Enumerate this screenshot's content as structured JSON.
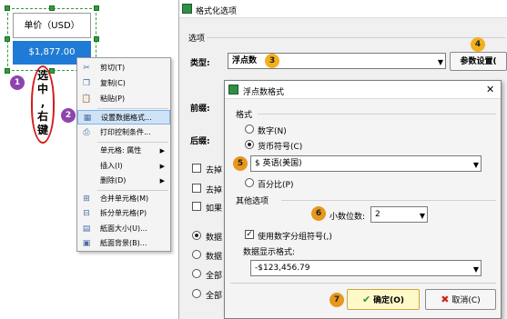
{
  "designer": {
    "unit_label": "单价（USD）",
    "value": "$1,877.00",
    "note_chars": [
      "选",
      "中",
      ",",
      "右",
      "键"
    ]
  },
  "badges": [
    "1",
    "2",
    "3",
    "4",
    "5",
    "6",
    "7"
  ],
  "context_menu": {
    "items": [
      {
        "label": "剪切(T)",
        "icon": "scissors-icon"
      },
      {
        "label": "复制(C)",
        "icon": "copy-icon"
      },
      {
        "label": "粘贴(P)",
        "icon": "paste-icon"
      },
      {
        "label": "设置数据格式...",
        "icon": "format-icon"
      },
      {
        "label": "打印控制条件...",
        "icon": "print-icon"
      },
      {
        "label": "单元格: 属性",
        "icon": ""
      },
      {
        "label": "插入(I)",
        "icon": ""
      },
      {
        "label": "删除(D)",
        "icon": ""
      },
      {
        "label": "合并单元格(M)",
        "icon": "merge-icon"
      },
      {
        "label": "拆分单元格(P)",
        "icon": "split-icon"
      },
      {
        "label": "紙面大小(U)...",
        "icon": "page-size-icon"
      },
      {
        "label": "紙面背景(B)...",
        "icon": "background-icon"
      }
    ]
  },
  "format_dialog": {
    "title": "格式化选项",
    "options_group": "选项",
    "type_label": "类型:",
    "type_value": "浮点数",
    "settings_button": "参数设置(",
    "prefix_label": "前缀:",
    "suffix_label": "后缀:",
    "partial_checks": [
      "去掉",
      "去掉",
      "如果"
    ],
    "partial_radios": [
      "数据",
      "数据",
      "全部",
      "全部"
    ]
  },
  "float_dialog": {
    "title": "浮点数格式",
    "format_group": "格式",
    "radio_number": "数字(N)",
    "radio_currency": "货币符号(C)",
    "currency_value": "$ 英语(美国)",
    "radio_percent": "百分比(P)",
    "other_group": "其他选项",
    "decimal_label": "小数位数:",
    "decimal_value": "2",
    "thousands_check": "使用数字分组符号(,)",
    "thousands_checked": true,
    "display_format_label": "数据显示格式:",
    "display_format_value": "-$123,456.79",
    "ok_button": "确定(O)",
    "cancel_button": "取消(C)"
  }
}
